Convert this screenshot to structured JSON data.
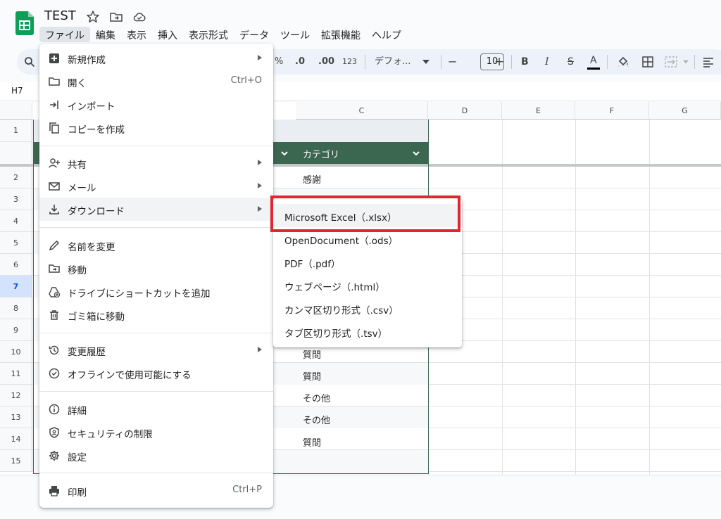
{
  "app": {
    "title": "TEST",
    "brand_color": "#0f9d58"
  },
  "menubar": [
    "ファイル",
    "編集",
    "表示",
    "挿入",
    "表示形式",
    "データ",
    "ツール",
    "拡張機能",
    "ヘルプ"
  ],
  "toolbar": {
    "percent": "%",
    "decimal_decrease": ".0",
    "decimal_increase": ".00",
    "number_format": "123",
    "font": "デフォ...",
    "minus": "−",
    "font_size": "10",
    "plus": "+",
    "bold": "B",
    "italic": "I",
    "strike": "S",
    "text_color": "A"
  },
  "formula_bar": {
    "cell_ref": "H7"
  },
  "grid": {
    "columns": [
      "C",
      "D",
      "E",
      "F",
      "G"
    ],
    "rows": [
      "1",
      "2",
      "3",
      "4",
      "5",
      "6",
      "7",
      "8",
      "9",
      "10",
      "11",
      "12",
      "13",
      "14",
      "15"
    ],
    "selected_row": "7",
    "table_header": "カテゴリ",
    "category_values": [
      "感謝",
      "質問",
      "質問",
      "その他",
      "その他",
      "質問"
    ],
    "table_color": "#3b664f"
  },
  "file_menu": {
    "new": "新規作成",
    "open": "開く",
    "open_shortcut": "Ctrl+O",
    "import": "インポート",
    "copy": "コピーを作成",
    "share": "共有",
    "email": "メール",
    "download": "ダウンロード",
    "rename": "名前を変更",
    "move": "移動",
    "shortcut": "ドライブにショートカットを追加",
    "trash": "ゴミ箱に移動",
    "history": "変更履歴",
    "offline": "オフラインで使用可能にする",
    "details": "詳細",
    "security": "セキュリティの制限",
    "settings": "設定",
    "print": "印刷",
    "print_shortcut": "Ctrl+P"
  },
  "download_menu": {
    "xlsx": "Microsoft Excel（.xlsx）",
    "ods": "OpenDocument（.ods）",
    "pdf": "PDF（.pdf）",
    "html": "ウェブページ（.html）",
    "csv": "カンマ区切り形式（.csv）",
    "tsv": "タブ区切り形式（.tsv）",
    "highlight_color": "#e0262f"
  }
}
